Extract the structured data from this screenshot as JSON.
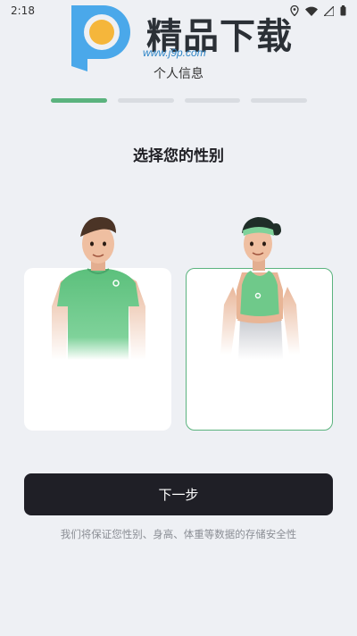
{
  "status_bar": {
    "time": "2:18"
  },
  "watermark": {
    "brand": "精品下载",
    "url": "www.j9p.com"
  },
  "header": {
    "step_title": "个人信息"
  },
  "progress": {
    "total_steps": 4,
    "current_step": 1
  },
  "main": {
    "title": "选择您的性别",
    "options": [
      {
        "value": "male",
        "selected": false
      },
      {
        "value": "female",
        "selected": true
      }
    ]
  },
  "footer": {
    "next_label": "下一步",
    "privacy_note": "我们将保证您性别、身高、体重等数据的存储安全性"
  },
  "colors": {
    "accent": "#5bb37e",
    "button_bg": "#1f1f26",
    "page_bg": "#eef0f4"
  }
}
